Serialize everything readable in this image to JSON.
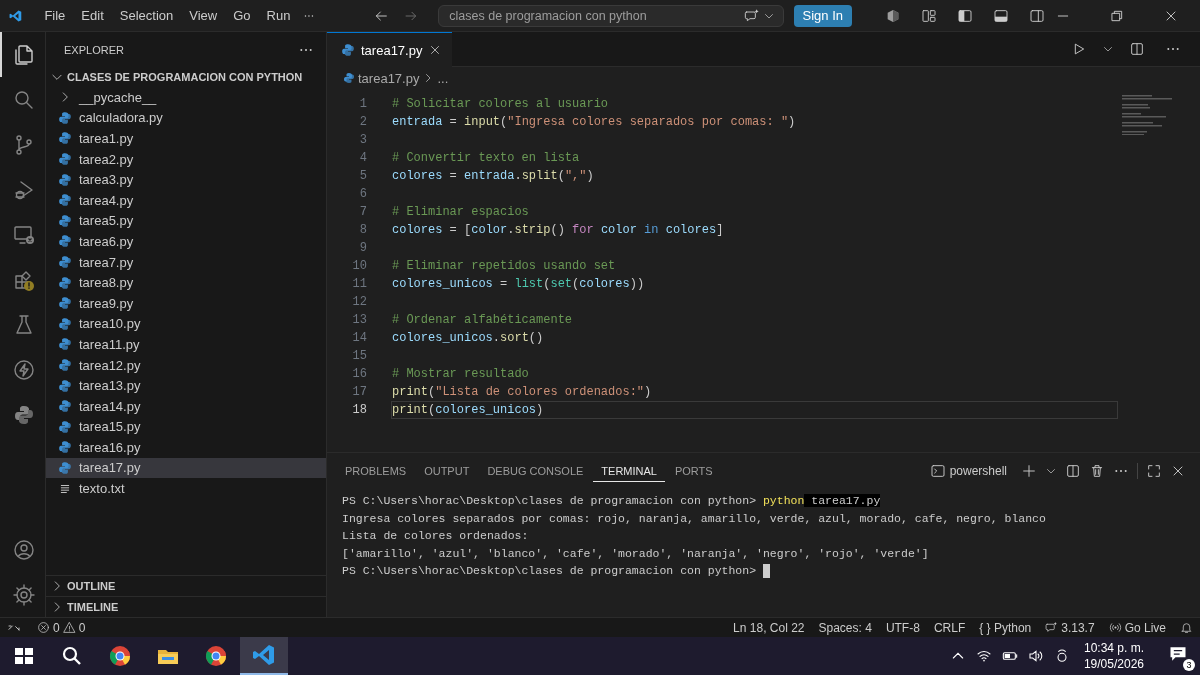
{
  "title_bar": {
    "menu": [
      "File",
      "Edit",
      "Selection",
      "View",
      "Go",
      "Run"
    ],
    "search": "clases de programacion con python",
    "sign_in": "Sign In"
  },
  "activity_bar": [
    {
      "kind": "explorer",
      "selected": true
    },
    {
      "kind": "search",
      "selected": false
    },
    {
      "kind": "scm",
      "selected": false
    },
    {
      "kind": "debug",
      "selected": false
    },
    {
      "kind": "remote",
      "selected": false
    },
    {
      "kind": "extensions",
      "selected": false
    },
    {
      "kind": "testing",
      "selected": false
    },
    {
      "kind": "bolt",
      "selected": false
    },
    {
      "kind": "python",
      "selected": false
    }
  ],
  "sidebar": {
    "title": "EXPLORER",
    "tree": {
      "label": "CLASES DE PROGRAMACION CON PYTHON",
      "expanded": true,
      "children": [
        {
          "label": "__pycache__",
          "kind": "folder",
          "expanded": false,
          "selected": false
        },
        {
          "label": "calculadora.py",
          "kind": "python",
          "selected": false
        },
        {
          "label": "tarea1.py",
          "kind": "python",
          "selected": false
        },
        {
          "label": "tarea2.py",
          "kind": "python",
          "selected": false
        },
        {
          "label": "tarea3.py",
          "kind": "python",
          "selected": false
        },
        {
          "label": "tarea4.py",
          "kind": "python",
          "selected": false
        },
        {
          "label": "tarea5.py",
          "kind": "python",
          "selected": false
        },
        {
          "label": "tarea6.py",
          "kind": "python",
          "selected": false
        },
        {
          "label": "tarea7.py",
          "kind": "python",
          "selected": false
        },
        {
          "label": "tarea8.py",
          "kind": "python",
          "selected": false
        },
        {
          "label": "tarea9.py",
          "kind": "python",
          "selected": false
        },
        {
          "label": "tarea10.py",
          "kind": "python",
          "selected": false
        },
        {
          "label": "tarea11.py",
          "kind": "python",
          "selected": false
        },
        {
          "label": "tarea12.py",
          "kind": "python",
          "selected": false
        },
        {
          "label": "tarea13.py",
          "kind": "python",
          "selected": false
        },
        {
          "label": "tarea14.py",
          "kind": "python",
          "selected": false
        },
        {
          "label": "tarea15.py",
          "kind": "python",
          "selected": false
        },
        {
          "label": "tarea16.py",
          "kind": "python",
          "selected": false
        },
        {
          "label": "tarea17.py",
          "kind": "python",
          "selected": true
        },
        {
          "label": "texto.txt",
          "kind": "text",
          "selected": false
        }
      ]
    },
    "sections": [
      {
        "label": "OUTLINE",
        "expanded": false
      },
      {
        "label": "TIMELINE",
        "expanded": false
      }
    ]
  },
  "editor": {
    "tabs": [
      {
        "label": "tarea17.py",
        "selected": true
      }
    ],
    "breadcrumb": {
      "file": "tarea17.py",
      "rest": "..."
    },
    "lines": [
      {
        "number": "1",
        "current": false,
        "tokens": [
          {
            "kind": "comment",
            "text": "# Solicitar colores al usuario"
          }
        ]
      },
      {
        "number": "2",
        "current": false,
        "tokens": [
          {
            "kind": "var",
            "text": "entrada"
          },
          {
            "kind": "plain",
            "text": " = "
          },
          {
            "kind": "func",
            "text": "input"
          },
          {
            "kind": "plain",
            "text": "("
          },
          {
            "kind": "string",
            "text": "\"Ingresa colores separados por comas: \""
          },
          {
            "kind": "plain",
            "text": ")"
          }
        ]
      },
      {
        "number": "3",
        "current": false
      },
      {
        "number": "4",
        "current": false,
        "tokens": [
          {
            "kind": "comment",
            "text": "# Convertir texto en lista"
          }
        ]
      },
      {
        "number": "5",
        "current": false,
        "tokens": [
          {
            "kind": "var",
            "text": "colores"
          },
          {
            "kind": "plain",
            "text": " = "
          },
          {
            "kind": "var",
            "text": "entrada"
          },
          {
            "kind": "plain",
            "text": "."
          },
          {
            "kind": "func",
            "text": "split"
          },
          {
            "kind": "plain",
            "text": "("
          },
          {
            "kind": "string",
            "text": "\",\""
          },
          {
            "kind": "plain",
            "text": ")"
          }
        ]
      },
      {
        "number": "6",
        "current": false
      },
      {
        "number": "7",
        "current": false,
        "tokens": [
          {
            "kind": "comment",
            "text": "# Eliminar espacios"
          }
        ]
      },
      {
        "number": "8",
        "current": false,
        "tokens": [
          {
            "kind": "var",
            "text": "colores"
          },
          {
            "kind": "plain",
            "text": " = ["
          },
          {
            "kind": "var",
            "text": "color"
          },
          {
            "kind": "plain",
            "text": "."
          },
          {
            "kind": "func",
            "text": "strip"
          },
          {
            "kind": "plain",
            "text": "() "
          },
          {
            "kind": "control",
            "text": "for"
          },
          {
            "kind": "var",
            "text": " color"
          },
          {
            "kind": "keyword",
            "text": " in"
          },
          {
            "kind": "var",
            "text": " colores"
          },
          {
            "kind": "plain",
            "text": "]"
          }
        ]
      },
      {
        "number": "9",
        "current": false
      },
      {
        "number": "10",
        "current": false,
        "tokens": [
          {
            "kind": "comment",
            "text": "# Eliminar repetidos usando set"
          }
        ]
      },
      {
        "number": "11",
        "current": false,
        "tokens": [
          {
            "kind": "var",
            "text": "colores_unicos"
          },
          {
            "kind": "plain",
            "text": " = "
          },
          {
            "kind": "type",
            "text": "list"
          },
          {
            "kind": "plain",
            "text": "("
          },
          {
            "kind": "type",
            "text": "set"
          },
          {
            "kind": "plain",
            "text": "("
          },
          {
            "kind": "var",
            "text": "colores"
          },
          {
            "kind": "plain",
            "text": "))"
          }
        ]
      },
      {
        "number": "12",
        "current": false
      },
      {
        "number": "13",
        "current": false,
        "tokens": [
          {
            "kind": "comment",
            "text": "# Ordenar alfabéticamente"
          }
        ]
      },
      {
        "number": "14",
        "current": false,
        "tokens": [
          {
            "kind": "var",
            "text": "colores_unicos"
          },
          {
            "kind": "plain",
            "text": "."
          },
          {
            "kind": "func",
            "text": "sort"
          },
          {
            "kind": "plain",
            "text": "()"
          }
        ]
      },
      {
        "number": "15",
        "current": false
      },
      {
        "number": "16",
        "current": false,
        "tokens": [
          {
            "kind": "comment",
            "text": "# Mostrar resultado"
          }
        ]
      },
      {
        "number": "17",
        "current": false,
        "tokens": [
          {
            "kind": "func",
            "text": "print"
          },
          {
            "kind": "plain",
            "text": "("
          },
          {
            "kind": "string",
            "text": "\"Lista de colores ordenados:\""
          },
          {
            "kind": "plain",
            "text": ")"
          }
        ]
      },
      {
        "number": "18",
        "current": true,
        "tokens": [
          {
            "kind": "func",
            "text": "print"
          },
          {
            "kind": "plain",
            "text": "("
          },
          {
            "kind": "var",
            "text": "colores_unicos"
          },
          {
            "kind": "plain",
            "text": ")"
          }
        ]
      }
    ]
  },
  "panel": {
    "tabs": [
      {
        "label": "PROBLEMS",
        "selected": false
      },
      {
        "label": "OUTPUT",
        "selected": false
      },
      {
        "label": "DEBUG CONSOLE",
        "selected": false
      },
      {
        "label": "TERMINAL",
        "selected": true
      },
      {
        "label": "PORTS",
        "selected": false
      }
    ],
    "shell": "powershell",
    "terminal": [
      {
        "kind": "command",
        "prompt": "PS C:\\Users\\horac\\Desktop\\clases de programacion con python> ",
        "command": "python",
        "arg": " tarea17.py"
      },
      {
        "kind": "output",
        "text": "Ingresa colores separados por comas: rojo, naranja, amarillo, verde, azul, morado, cafe, negro, blanco"
      },
      {
        "kind": "output",
        "text": "Lista de colores ordenados:"
      },
      {
        "kind": "output",
        "text": "['amarillo', 'azul', 'blanco', 'cafe', 'morado', 'naranja', 'negro', 'rojo', 'verde']"
      },
      {
        "kind": "prompt",
        "prompt": "PS C:\\Users\\horac\\Desktop\\clases de programacion con python> ",
        "cursor": true
      }
    ]
  },
  "status_bar": {
    "errors": "0",
    "warnings": "0",
    "items": [
      "Ln 18, Col 22",
      "Spaces: 4",
      "UTF-8",
      "CRLF",
      "{ } Python"
    ],
    "version": "3.13.7",
    "go_live": "Go Live"
  },
  "taskbar": {
    "apps": [
      {
        "kind": "start",
        "selected": false
      },
      {
        "kind": "search",
        "selected": false
      },
      {
        "kind": "chrome",
        "selected": false
      },
      {
        "kind": "folder",
        "selected": false
      },
      {
        "kind": "chrome",
        "selected": false
      },
      {
        "kind": "vscode",
        "selected": true
      }
    ],
    "time": "10:34 p. m.",
    "date": "19/05/2026",
    "notifications": "3"
  }
}
